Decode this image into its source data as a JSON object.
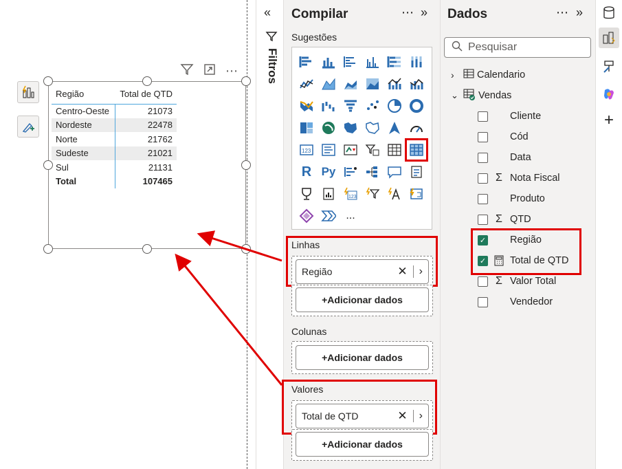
{
  "canvas": {
    "table": {
      "headers": [
        "Região",
        "Total de QTD"
      ],
      "rows": [
        {
          "regiao": "Centro-Oeste",
          "qtd": "21073"
        },
        {
          "regiao": "Nordeste",
          "qtd": "22478"
        },
        {
          "regiao": "Norte",
          "qtd": "21762"
        },
        {
          "regiao": "Sudeste",
          "qtd": "21021"
        },
        {
          "regiao": "Sul",
          "qtd": "21131"
        }
      ],
      "total_label": "Total",
      "total_value": "107465"
    }
  },
  "filters": {
    "label": "Filtros"
  },
  "build": {
    "title": "Compilar",
    "suggestions_label": "Sugestões",
    "rows_label": "Linhas",
    "rows_field": "Região",
    "columns_label": "Colunas",
    "values_label": "Valores",
    "values_field": "Total de QTD",
    "add_data": "+Adicionar dados",
    "more": "..."
  },
  "data_pane": {
    "title": "Dados",
    "search_placeholder": "Pesquisar",
    "tables": [
      {
        "name": "Calendario",
        "expanded": false
      },
      {
        "name": "Vendas",
        "expanded": true
      }
    ],
    "fields": [
      {
        "name": "Cliente",
        "sigma": false,
        "checked": false
      },
      {
        "name": "Cód",
        "sigma": false,
        "checked": false
      },
      {
        "name": "Data",
        "sigma": false,
        "checked": false
      },
      {
        "name": "Nota Fiscal",
        "sigma": true,
        "checked": false
      },
      {
        "name": "Produto",
        "sigma": false,
        "checked": false
      },
      {
        "name": "QTD",
        "sigma": true,
        "checked": false
      },
      {
        "name": "Região",
        "sigma": false,
        "checked": true
      },
      {
        "name": "Total de QTD",
        "sigma": false,
        "calc": true,
        "checked": true
      },
      {
        "name": "Valor Total",
        "sigma": true,
        "checked": false
      },
      {
        "name": "Vendedor",
        "sigma": false,
        "checked": false
      }
    ]
  },
  "colors": {
    "highlight": "#e00000",
    "accent": "#4ea6dc",
    "check": "#1f7a5b"
  }
}
